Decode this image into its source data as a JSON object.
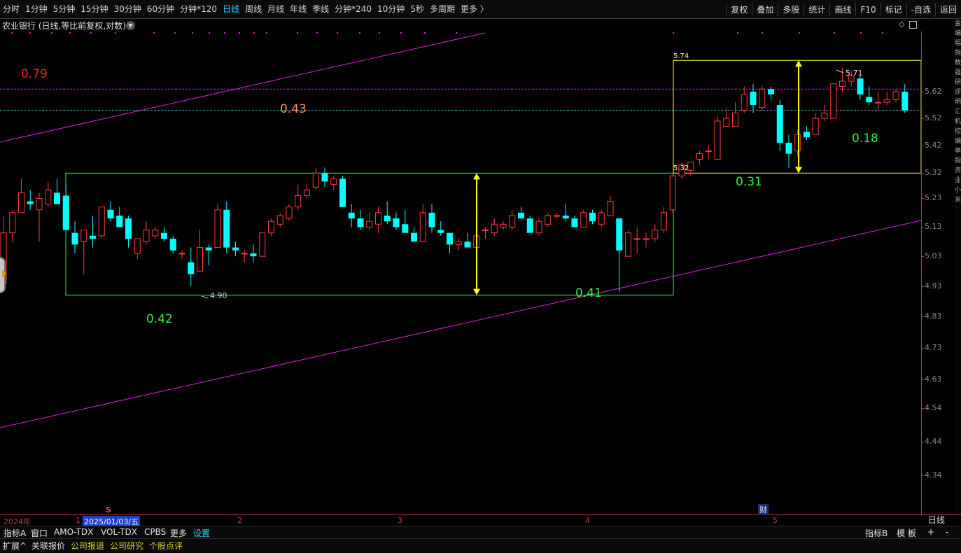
{
  "period_tabs": [
    "分时",
    "1分钟",
    "5分钟",
    "15分钟",
    "30分钟",
    "60分钟",
    "分钟*120",
    "日线",
    "周线",
    "月线",
    "年线",
    "季线",
    "分钟*240",
    "10分钟",
    "5秒",
    "多周期",
    "更多 〉"
  ],
  "active_period": "日线",
  "toolbar_right": [
    "复权",
    "叠加",
    "多股",
    "统计",
    "画线",
    "F10",
    "标记",
    "-自选",
    "返回"
  ],
  "chart_title": "农业银行 (日线,等比前复权,对数)",
  "price_axis": {
    "ticks": [
      "5.62",
      "5.52",
      "5.42",
      "5.32",
      "5.23",
      "5.13",
      "5.03",
      "4.93",
      "4.83",
      "4.73",
      "4.63",
      "4.54",
      "4.44",
      "4.34"
    ],
    "scale": "log"
  },
  "annotations": {
    "box1_bottom_label": "0.42",
    "box1_height_label": "0.43",
    "box2_top_label": "0.31",
    "box2_height_label": "0.18",
    "upper_channel_label": "0.79",
    "lower_channel_label": "0.41",
    "box1_low_marker": "4.90",
    "box2_high_marker": "5.74",
    "box2_low_marker": "5.32",
    "peak_marker": "5.71"
  },
  "date_axis": {
    "year_label": "2024年",
    "cursor_date": "2025/01/03/五",
    "months": [
      "1",
      "2",
      "3",
      "4",
      "5"
    ],
    "right_label": "日线",
    "event_flag": "财",
    "flag_s": "S"
  },
  "indicator_tabs": [
    "指标A",
    "窗口",
    "AMO-TDX",
    "VOL-TDX",
    "CPBS",
    "更多",
    "设置"
  ],
  "indicator_tabs_right": [
    "指标B",
    "模 板",
    "+",
    "-"
  ],
  "bottom_tabs": [
    "扩展^",
    "关联报价",
    "公司报道",
    "公司研究",
    "个股点评"
  ],
  "side_strip_chars": [
    "金",
    "编",
    "幅",
    "指",
    "数",
    "强",
    "研",
    "评",
    "明",
    "汇",
    "机",
    "控",
    "编",
    "单",
    "指",
    "资",
    "业",
    "小",
    "来"
  ],
  "colors": {
    "up": "#ff3b3b",
    "down": "#00ffff",
    "box1": "#22ff44",
    "box2": "#ffff33",
    "channel": "#e020e0",
    "arrow": "#ffff00",
    "label_green": "#33ee44",
    "label_red": "#ff2020",
    "label_orange": "#ff8c6a",
    "price_line_pink": "#e020e0",
    "price_line_blue": "#4aa7c8"
  },
  "chart_data": {
    "type": "candlestick",
    "candles": [
      {
        "o": 4.94,
        "h": 5.17,
        "l": 4.93,
        "c": 5.11
      },
      {
        "o": 5.11,
        "h": 5.19,
        "l": 5.08,
        "c": 5.18
      },
      {
        "o": 5.18,
        "h": 5.3,
        "l": 5.18,
        "c": 5.25
      },
      {
        "o": 5.22,
        "h": 5.26,
        "l": 5.19,
        "c": 5.21
      },
      {
        "o": 5.19,
        "h": 5.25,
        "l": 5.08,
        "c": 5.23
      },
      {
        "o": 5.21,
        "h": 5.29,
        "l": 5.2,
        "c": 5.26
      },
      {
        "o": 5.25,
        "h": 5.3,
        "l": 5.23,
        "c": 5.21
      },
      {
        "o": 5.24,
        "h": 5.28,
        "l": 5.12,
        "c": 5.12
      },
      {
        "o": 5.11,
        "h": 5.15,
        "l": 5.04,
        "c": 5.07
      },
      {
        "o": 5.08,
        "h": 5.12,
        "l": 4.97,
        "c": 5.12
      },
      {
        "o": 5.1,
        "h": 5.17,
        "l": 5.06,
        "c": 5.09
      },
      {
        "o": 5.1,
        "h": 5.2,
        "l": 5.09,
        "c": 5.2
      },
      {
        "o": 5.19,
        "h": 5.22,
        "l": 5.15,
        "c": 5.16
      },
      {
        "o": 5.17,
        "h": 5.2,
        "l": 5.13,
        "c": 5.13
      },
      {
        "o": 5.16,
        "h": 5.17,
        "l": 5.06,
        "c": 5.09
      },
      {
        "o": 5.04,
        "h": 5.09,
        "l": 5.02,
        "c": 5.09
      },
      {
        "o": 5.08,
        "h": 5.15,
        "l": 5.07,
        "c": 5.12
      },
      {
        "o": 5.1,
        "h": 5.13,
        "l": 5.09,
        "c": 5.12
      },
      {
        "o": 5.11,
        "h": 5.13,
        "l": 5.08,
        "c": 5.09
      },
      {
        "o": 5.09,
        "h": 5.1,
        "l": 5.04,
        "c": 5.05
      },
      {
        "o": 5.04,
        "h": 5.05,
        "l": 5.02,
        "c": 5.04
      },
      {
        "o": 5.01,
        "h": 5.06,
        "l": 4.93,
        "c": 4.97
      },
      {
        "o": 4.98,
        "h": 5.12,
        "l": 4.98,
        "c": 5.06
      },
      {
        "o": 5.06,
        "h": 5.07,
        "l": 5.0,
        "c": 5.05
      },
      {
        "o": 5.06,
        "h": 5.21,
        "l": 5.06,
        "c": 5.19
      },
      {
        "o": 5.19,
        "h": 5.22,
        "l": 5.04,
        "c": 5.06
      },
      {
        "o": 5.06,
        "h": 5.08,
        "l": 5.03,
        "c": 5.05
      },
      {
        "o": 5.04,
        "h": 5.05,
        "l": 5.01,
        "c": 5.04
      },
      {
        "o": 5.04,
        "h": 5.07,
        "l": 5.01,
        "c": 5.03
      },
      {
        "o": 5.03,
        "h": 5.11,
        "l": 5.03,
        "c": 5.11
      },
      {
        "o": 5.11,
        "h": 5.16,
        "l": 5.1,
        "c": 5.15
      },
      {
        "o": 5.14,
        "h": 5.18,
        "l": 5.13,
        "c": 5.17
      },
      {
        "o": 5.16,
        "h": 5.21,
        "l": 5.15,
        "c": 5.2
      },
      {
        "o": 5.2,
        "h": 5.28,
        "l": 5.19,
        "c": 5.24
      },
      {
        "o": 5.24,
        "h": 5.28,
        "l": 5.23,
        "c": 5.26
      },
      {
        "o": 5.27,
        "h": 5.34,
        "l": 5.26,
        "c": 5.32
      },
      {
        "o": 5.32,
        "h": 5.34,
        "l": 5.27,
        "c": 5.29
      },
      {
        "o": 5.28,
        "h": 5.31,
        "l": 5.26,
        "c": 5.3
      },
      {
        "o": 5.3,
        "h": 5.31,
        "l": 5.2,
        "c": 5.2
      },
      {
        "o": 5.18,
        "h": 5.21,
        "l": 5.13,
        "c": 5.16
      },
      {
        "o": 5.16,
        "h": 5.19,
        "l": 5.12,
        "c": 5.13
      },
      {
        "o": 5.13,
        "h": 5.18,
        "l": 5.12,
        "c": 5.15
      },
      {
        "o": 5.14,
        "h": 5.2,
        "l": 5.11,
        "c": 5.18
      },
      {
        "o": 5.17,
        "h": 5.22,
        "l": 5.14,
        "c": 5.15
      },
      {
        "o": 5.16,
        "h": 5.18,
        "l": 5.12,
        "c": 5.13
      },
      {
        "o": 5.14,
        "h": 5.19,
        "l": 5.12,
        "c": 5.11
      },
      {
        "o": 5.11,
        "h": 5.13,
        "l": 5.08,
        "c": 5.08
      },
      {
        "o": 5.08,
        "h": 5.21,
        "l": 5.08,
        "c": 5.18
      },
      {
        "o": 5.18,
        "h": 5.21,
        "l": 5.11,
        "c": 5.13
      },
      {
        "o": 5.12,
        "h": 5.15,
        "l": 5.1,
        "c": 5.11
      },
      {
        "o": 5.11,
        "h": 5.11,
        "l": 5.04,
        "c": 5.07
      },
      {
        "o": 5.07,
        "h": 5.09,
        "l": 5.05,
        "c": 5.08
      },
      {
        "o": 5.08,
        "h": 5.11,
        "l": 5.06,
        "c": 5.06
      },
      {
        "o": 5.06,
        "h": 5.11,
        "l": 5.05,
        "c": 5.1
      },
      {
        "o": 5.12,
        "h": 5.13,
        "l": 5.09,
        "c": 5.12
      },
      {
        "o": 5.11,
        "h": 5.16,
        "l": 5.1,
        "c": 5.14
      },
      {
        "o": 5.13,
        "h": 5.15,
        "l": 5.12,
        "c": 5.14
      },
      {
        "o": 5.13,
        "h": 5.19,
        "l": 5.12,
        "c": 5.17
      },
      {
        "o": 5.18,
        "h": 5.2,
        "l": 5.16,
        "c": 5.16
      },
      {
        "o": 5.16,
        "h": 5.17,
        "l": 5.11,
        "c": 5.11
      },
      {
        "o": 5.11,
        "h": 5.16,
        "l": 5.1,
        "c": 5.15
      },
      {
        "o": 5.14,
        "h": 5.18,
        "l": 5.13,
        "c": 5.17
      },
      {
        "o": 5.17,
        "h": 5.18,
        "l": 5.16,
        "c": 5.17
      },
      {
        "o": 5.17,
        "h": 5.21,
        "l": 5.15,
        "c": 5.16
      },
      {
        "o": 5.16,
        "h": 5.17,
        "l": 5.13,
        "c": 5.13
      },
      {
        "o": 5.13,
        "h": 5.19,
        "l": 5.13,
        "c": 5.18
      },
      {
        "o": 5.18,
        "h": 5.19,
        "l": 5.14,
        "c": 5.15
      },
      {
        "o": 5.14,
        "h": 5.19,
        "l": 5.13,
        "c": 5.18
      },
      {
        "o": 5.17,
        "h": 5.24,
        "l": 5.17,
        "c": 5.22
      },
      {
        "o": 5.16,
        "h": 5.16,
        "l": 4.91,
        "c": 5.05
      },
      {
        "o": 5.03,
        "h": 5.12,
        "l": 5.03,
        "c": 5.11
      },
      {
        "o": 5.09,
        "h": 5.13,
        "l": 5.04,
        "c": 5.09
      },
      {
        "o": 5.09,
        "h": 5.11,
        "l": 5.06,
        "c": 5.09
      },
      {
        "o": 5.09,
        "h": 5.14,
        "l": 5.08,
        "c": 5.12
      },
      {
        "o": 5.12,
        "h": 5.2,
        "l": 5.11,
        "c": 5.18
      },
      {
        "o": 5.19,
        "h": 5.31,
        "l": 5.18,
        "c": 5.31
      },
      {
        "o": 5.31,
        "h": 5.36,
        "l": 5.3,
        "c": 5.35
      },
      {
        "o": 5.33,
        "h": 5.36,
        "l": 5.31,
        "c": 5.36
      },
      {
        "o": 5.37,
        "h": 5.4,
        "l": 5.35,
        "c": 5.39
      },
      {
        "o": 5.4,
        "h": 5.42,
        "l": 5.37,
        "c": 5.4
      },
      {
        "o": 5.37,
        "h": 5.53,
        "l": 5.37,
        "c": 5.51
      },
      {
        "o": 5.49,
        "h": 5.56,
        "l": 5.49,
        "c": 5.52
      },
      {
        "o": 5.49,
        "h": 5.58,
        "l": 5.49,
        "c": 5.54
      },
      {
        "o": 5.55,
        "h": 5.64,
        "l": 5.54,
        "c": 5.61
      },
      {
        "o": 5.62,
        "h": 5.65,
        "l": 5.54,
        "c": 5.57
      },
      {
        "o": 5.56,
        "h": 5.64,
        "l": 5.55,
        "c": 5.63
      },
      {
        "o": 5.63,
        "h": 5.64,
        "l": 5.59,
        "c": 5.61
      },
      {
        "o": 5.57,
        "h": 5.59,
        "l": 5.4,
        "c": 5.43
      },
      {
        "o": 5.43,
        "h": 5.46,
        "l": 5.34,
        "c": 5.39
      },
      {
        "o": 5.4,
        "h": 5.48,
        "l": 5.38,
        "c": 5.46
      },
      {
        "o": 5.47,
        "h": 5.49,
        "l": 5.44,
        "c": 5.45
      },
      {
        "o": 5.46,
        "h": 5.54,
        "l": 5.46,
        "c": 5.52
      },
      {
        "o": 5.52,
        "h": 5.57,
        "l": 5.51,
        "c": 5.54
      },
      {
        "o": 5.52,
        "h": 5.65,
        "l": 5.52,
        "c": 5.65
      },
      {
        "o": 5.64,
        "h": 5.71,
        "l": 5.62,
        "c": 5.66
      },
      {
        "o": 5.66,
        "h": 5.7,
        "l": 5.64,
        "c": 5.68
      },
      {
        "o": 5.67,
        "h": 5.68,
        "l": 5.59,
        "c": 5.61
      },
      {
        "o": 5.6,
        "h": 5.64,
        "l": 5.57,
        "c": 5.58
      },
      {
        "o": 5.58,
        "h": 5.62,
        "l": 5.55,
        "c": 5.58
      },
      {
        "o": 5.58,
        "h": 5.62,
        "l": 5.57,
        "c": 5.59
      },
      {
        "o": 5.59,
        "h": 5.63,
        "l": 5.58,
        "c": 5.62
      },
      {
        "o": 5.62,
        "h": 5.65,
        "l": 5.54,
        "c": 5.55
      }
    ],
    "box1": {
      "top": 5.32,
      "bottom": 4.9
    },
    "box2": {
      "top": 5.74,
      "bottom": 5.32
    },
    "pink_price_line": 5.63,
    "blue_price_line": 5.55
  }
}
